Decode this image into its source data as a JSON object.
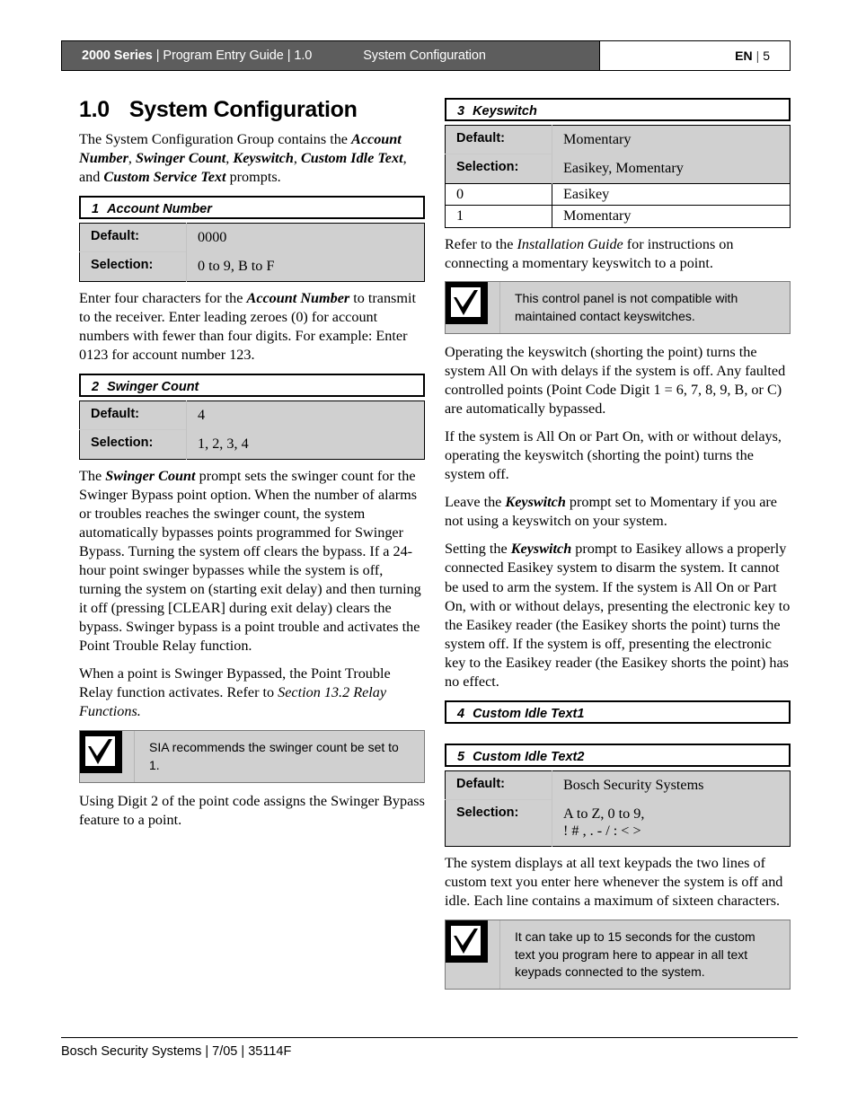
{
  "header": {
    "brand": "2000 Series",
    "divider": "|",
    "guide": "Program Entry Guide",
    "version": "1.0",
    "section": "System Configuration",
    "lang": "EN",
    "page": "5"
  },
  "left_column": {
    "section_number": "1.0",
    "section_title": "System Configuration",
    "intro": {
      "part1": "The System Configuration Group contains the ",
      "b1": "Account Number",
      "sep1": ", ",
      "b2": "Swinger Count",
      "sep2": ", ",
      "b3": "Keyswitch",
      "sep3": ", ",
      "b4": "Custom Idle Text",
      "sep4": ", and ",
      "b5": "Custom Service Text",
      "tail": " prompts."
    },
    "prompt1": {
      "num": "1",
      "name": "Account Number"
    },
    "table1": {
      "default_label": "Default:",
      "default_value": "0000",
      "selection_label": "Selection:",
      "selection_value": "0 to 9, B to F"
    },
    "para_account": {
      "p1": "Enter four characters for the ",
      "b1": "Account Number",
      "p2": " to transmit to the receiver. Enter leading zeroes (0) for account numbers with fewer than four digits. For example: Enter 0123 for account number 123."
    },
    "prompt2": {
      "num": "2",
      "name": "Swinger Count"
    },
    "table2": {
      "default_label": "Default:",
      "default_value": "4",
      "selection_label": "Selection:",
      "selection_value": "1, 2, 3, 4"
    },
    "para_swinger": {
      "p1": "The ",
      "b1": "Swinger Count",
      "p2": " prompt sets the swinger count for the Swinger Bypass point option. When the number of alarms or troubles reaches the swinger count, the system automatically bypasses points programmed for Swinger Bypass. Turning the system off clears the bypass. If a 24-hour point swinger bypasses while the system is off, turning the system on (starting exit delay) and then turning it off (pressing [CLEAR] during exit delay) clears the bypass. Swinger bypass is a point trouble and activates the Point Trouble Relay function."
    },
    "para_swinger2": {
      "p1": "When a point is Swinger Bypassed, the Point Trouble Relay function activates. Refer to ",
      "i1": "Section 13.2 Relay Functions."
    },
    "note1": {
      "icon": "checkmark-box-icon",
      "text": "SIA recommends the swinger count be set to 1."
    },
    "para_digit2": "Using Digit 2 of the point code assigns the Swinger Bypass feature to a point."
  },
  "right_column": {
    "prompt3": {
      "num": "3",
      "name": "Keyswitch"
    },
    "table3": {
      "default_label": "Default:",
      "default_value": "Momentary",
      "selection_label": "Selection:",
      "selection_value": "Easikey, Momentary",
      "options": [
        {
          "code": "0",
          "value": "Easikey"
        },
        {
          "code": "1",
          "value": "Momentary"
        }
      ]
    },
    "para_refer": {
      "p1": "Refer to the ",
      "i1": "Installation Guide",
      "p2": " for instructions on connecting a momentary keyswitch to a point."
    },
    "note2": {
      "icon": "checkmark-box-icon",
      "text": "This control panel is not compatible with maintained contact keyswitches."
    },
    "para_operating": "Operating the keyswitch (shorting the point) turns the system All On with delays if the system is off. Any faulted controlled points (Point Code Digit 1 = 6, 7, 8, 9, B, or C) are automatically bypassed.",
    "para_allon": "If the system is All On or Part On, with or without delays, operating the keyswitch (shorting the point) turns the system off.",
    "para_leave": {
      "p1": "Leave the ",
      "b1": "Keyswitch",
      "p2": " prompt set to Momentary if you are not using a keyswitch on your system."
    },
    "para_setting": {
      "p1": "Setting the ",
      "b1": "Keyswitch",
      "p2": " prompt to Easikey allows a properly connected Easikey system to disarm the system. It cannot be used to arm the system. If the system is All On or Part On, with or without delays, presenting the electronic key to the Easikey reader (the Easikey shorts the point) turns the system off. If the system is off, presenting the electronic key to the Easikey reader (the Easikey shorts the point) has no effect."
    },
    "prompt4": {
      "num": "4",
      "name": "Custom Idle Text1"
    },
    "prompt5": {
      "num": "5",
      "name": "Custom Idle Text2"
    },
    "table5": {
      "default_label": "Default:",
      "default_value": "Bosch Security Systems",
      "selection_label": "Selection:",
      "selection_line1": "A to Z, 0 to 9,",
      "selection_line2": "! # , . - / : < >"
    },
    "para_display": "The system displays at all text keypads the two lines of custom text you enter here whenever the system is off and idle. Each line contains a maximum of sixteen characters.",
    "note3": {
      "icon": "checkmark-box-icon",
      "text": "It can take up to 15 seconds for the custom text you program here to appear in all text keypads connected to the system."
    }
  },
  "footer": {
    "text": "Bosch Security Systems | 7/05 | 35114F"
  },
  "colors": {
    "header_bar": "#5d5d5d",
    "table_grey": "#d0d0d0",
    "note_grey": "#d0d0d0"
  }
}
